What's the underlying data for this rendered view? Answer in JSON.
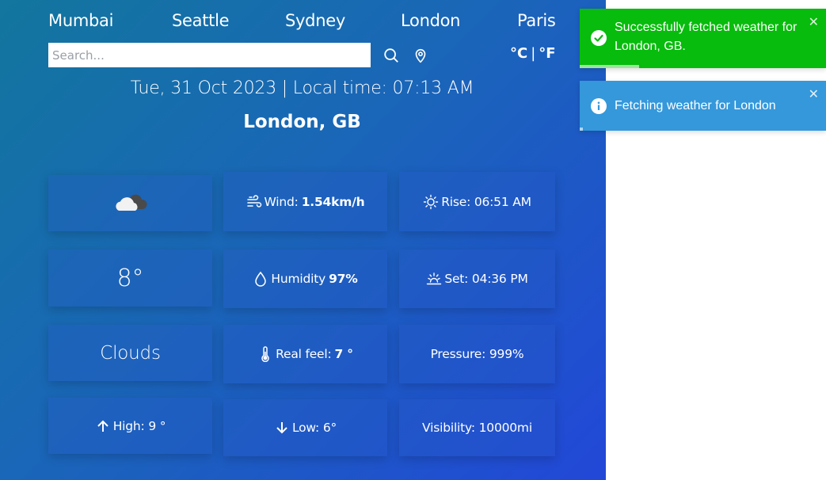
{
  "cities": [
    "Mumbai",
    "Seattle",
    "Sydney",
    "London",
    "Paris"
  ],
  "search": {
    "placeholder": "Search..."
  },
  "icons": {
    "search": "search-icon",
    "location": "location-pin-icon"
  },
  "units": {
    "celsius": "°C",
    "separator": "|",
    "fahrenheit": "°F"
  },
  "datetime": "Tue, 31 Oct 2023 | Local time: 07:13 AM",
  "location": "London, GB",
  "weather": {
    "temperature": "8°",
    "condition": "Clouds",
    "high_label": "High:",
    "high_value": "9 °",
    "low_label": "Low:",
    "low_value": "6°",
    "wind_label": "Wind:",
    "wind_value": "1.54km/h",
    "humidity_label": "Humidity",
    "humidity_value": "97%",
    "realfeel_label": "Real feel:",
    "realfeel_value": "7 °",
    "rise": "Rise: 06:51 AM",
    "set": "Set: 04:36 PM",
    "pressure": "Pressure: 999%",
    "visibility": "Visibility: 10000mi"
  },
  "toasts": {
    "success": {
      "message": "Successfully fetched weather for London, GB.",
      "close": "✕",
      "progress": 0.24,
      "color": "#07bc0c"
    },
    "info": {
      "message": "Fetching weather for London",
      "close": "✕",
      "color": "#3498db"
    }
  }
}
